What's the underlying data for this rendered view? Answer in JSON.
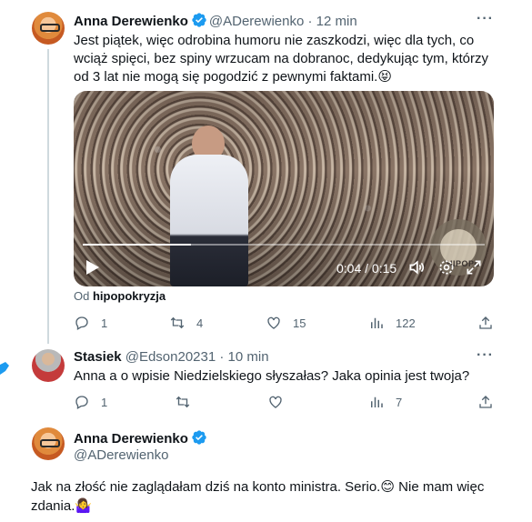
{
  "tweets": [
    {
      "name": "Anna Derewienko",
      "handle": "@ADerewienko",
      "separator": "·",
      "time": "12 min",
      "more": "···",
      "text": "Jest piątek, więc odrobina humoru nie zaszkodzi, więc dla tych, co wciąż spięci, bez spiny wrzucam na dobranoc, dedykując tym, którzy od 3 lat nie mogą się pogodzić z pewnymi faktami.😝",
      "video": {
        "time_readout": "0:04 / 0:15",
        "progress": 0.27,
        "watermark": "HIPOPO"
      },
      "from_label": "Od",
      "from_source": "hipopokryzja",
      "actions": {
        "replies": "1",
        "retweets": "4",
        "likes": "15",
        "views": "122"
      }
    },
    {
      "name": "Stasiek",
      "handle": "@Edson20231",
      "separator": "·",
      "time": "10 min",
      "more": "···",
      "text": "Anna a o wpisie Niedzielskiego słyszałas? Jaka opinia jest twoja?",
      "actions": {
        "replies": "1",
        "retweets": "",
        "likes": "",
        "views": "7"
      }
    },
    {
      "name": "Anna Derewienko",
      "handle": "@ADerewienko",
      "text": "Jak na złość nie zaglądałam dziś na konto ministra. Serio.😊 Nie mam więc zdania.🤷‍♀️"
    }
  ],
  "colors": {
    "verified": "#1d9bf0",
    "secondary_text": "#536471",
    "thread_line": "#cfd9de",
    "side_bird": "#1d9bf0"
  }
}
